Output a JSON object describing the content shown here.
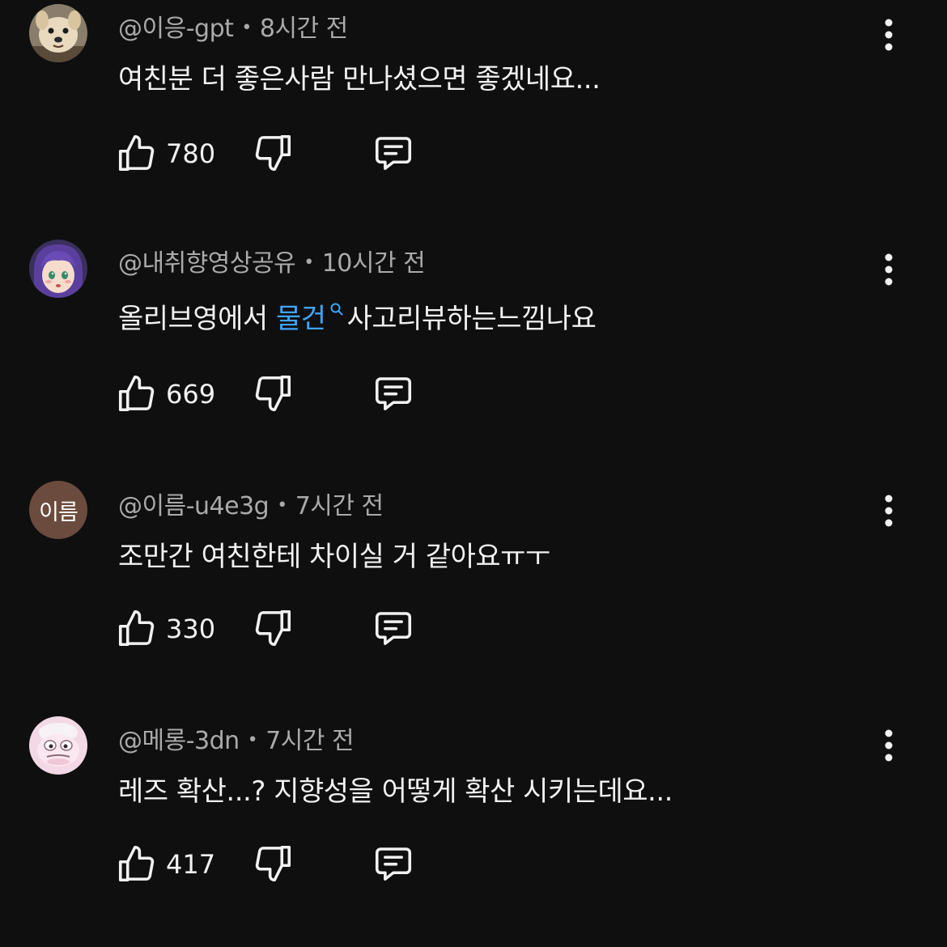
{
  "comments": [
    {
      "author": "@이응-gpt",
      "time": "8시간 전",
      "text": "여친분 더 좋은사람 만나셨으면 좋겠네요...",
      "likes": "780",
      "avatar": "dog-photo"
    },
    {
      "author": "@내취향영상공유",
      "time": "10시간 전",
      "text_before": "올리브영에서 ",
      "link_text": "물건",
      "text_after": "사고리뷰하는느낌나요",
      "likes": "669",
      "avatar": "anime-girl-photo"
    },
    {
      "author": "@이름-u4e3g",
      "time": "7시간 전",
      "text": "조만간 여친한테 차이실 거 같아요ㅠㅜ",
      "likes": "330",
      "avatar_text": "이름",
      "avatar_color": "#6b4b3e"
    },
    {
      "author": "@메롱-3dn",
      "time": "7시간 전",
      "text": "레즈 확산...? 지향성을 어떻게 확산 시키는데요...",
      "likes": "417",
      "avatar": "cartoon-character-photo"
    }
  ],
  "icons": {
    "like": "thumbs-up-icon",
    "dislike": "thumbs-down-icon",
    "reply": "reply-comment-icon",
    "more": "more-vertical-icon",
    "search": "search-icon"
  },
  "colors": {
    "background": "#0f0f0f",
    "text": "#f1f1f1",
    "meta": "#aaaaaa",
    "link": "#3ea6ff"
  }
}
